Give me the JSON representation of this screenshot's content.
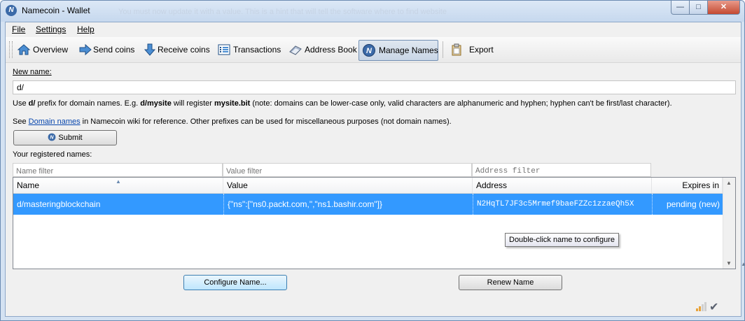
{
  "window": {
    "title": "Namecoin - Wallet",
    "ghost_text": "You must now update it with a value. This is a hint that will tell the software where to find website",
    "minimize_icon": "minimize-icon",
    "maximize_icon": "maximize-icon",
    "close_icon": "close-icon"
  },
  "menu": {
    "file": "File",
    "settings": "Settings",
    "help": "Help"
  },
  "toolbar": {
    "overview": "Overview",
    "send": "Send coins",
    "receive": "Receive coins",
    "transactions": "Transactions",
    "address_book": "Address Book",
    "manage_names": "Manage Names",
    "export": "Export"
  },
  "form": {
    "new_name_label": "New name:",
    "new_name_value": "d/",
    "help_line1": {
      "a": "Use ",
      "b": "d/",
      "c": " prefix for domain names. E.g. ",
      "d": "d/mysite",
      "e": " will register ",
      "f": "mysite.bit",
      "g": " (note: domains can be lower-case only, valid characters are alphanumeric and hyphen; hyphen can't be first/last character)."
    },
    "help_line2": {
      "a": "See ",
      "link": "Domain names",
      "b": " in Namecoin wiki for reference. Other prefixes can be used for miscellaneous purposes (not domain names)."
    },
    "submit_label": "Submit"
  },
  "registered": {
    "label": "Your registered names:",
    "filters": {
      "name": "Name filter",
      "value": "Value filter",
      "address": "Address filter"
    },
    "columns": {
      "name": "Name",
      "value": "Value",
      "address": "Address",
      "expires": "Expires in"
    },
    "rows": [
      {
        "name": "d/masteringblockchain",
        "value": "{\"ns\":[\"ns0.packt.com,\",\"ns1.bashir.com\"]}",
        "address": "N2HqTL7JF3c5Mrmef9baeFZZc1zzaeQh5X",
        "expires": "pending (new)"
      }
    ],
    "tooltip": "Double-click name to configure"
  },
  "actions": {
    "configure": "Configure Name...",
    "renew": "Renew Name"
  },
  "colors": {
    "selection": "#3399ff",
    "frame": "#d4e2f2",
    "accent": "#3c7fb1"
  }
}
